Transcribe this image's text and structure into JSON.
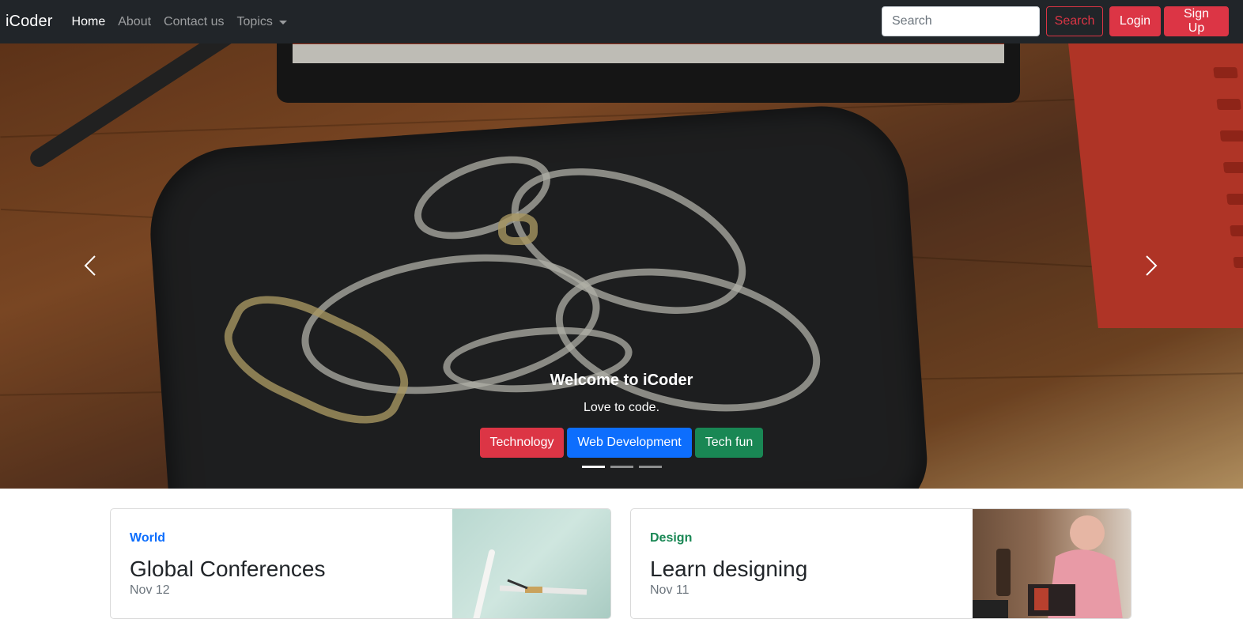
{
  "navbar": {
    "brand": "iCoder",
    "links": [
      {
        "label": "Home",
        "active": true
      },
      {
        "label": "About",
        "active": false
      },
      {
        "label": "Contact us",
        "active": false
      },
      {
        "label": "Topics",
        "active": false,
        "dropdown": true
      }
    ],
    "search": {
      "placeholder": "Search",
      "button_label": "Search"
    },
    "login_label": "Login",
    "signup_label": "Sign Up"
  },
  "carousel": {
    "caption_title": "Welcome to iCoder",
    "caption_text": "Love to code.",
    "buttons": [
      {
        "label": "Technology",
        "color": "#dc3545"
      },
      {
        "label": "Web Development",
        "color": "#0d6efd"
      },
      {
        "label": "Tech fun",
        "color": "#198754"
      }
    ],
    "indicators": 3,
    "active_slide": 1,
    "prev_icon": "chevron-left-icon",
    "next_icon": "chevron-right-icon"
  },
  "cards": [
    {
      "category": "World",
      "title": "Global Conferences",
      "date": "Nov 12",
      "category_color": "#0d6efd"
    },
    {
      "category": "Design",
      "title": "Learn designing",
      "date": "Nov 11",
      "category_color": "#198754"
    }
  ],
  "colors": {
    "navbar_bg": "#212529",
    "danger": "#dc3545",
    "primary": "#0d6efd",
    "success": "#198754"
  }
}
